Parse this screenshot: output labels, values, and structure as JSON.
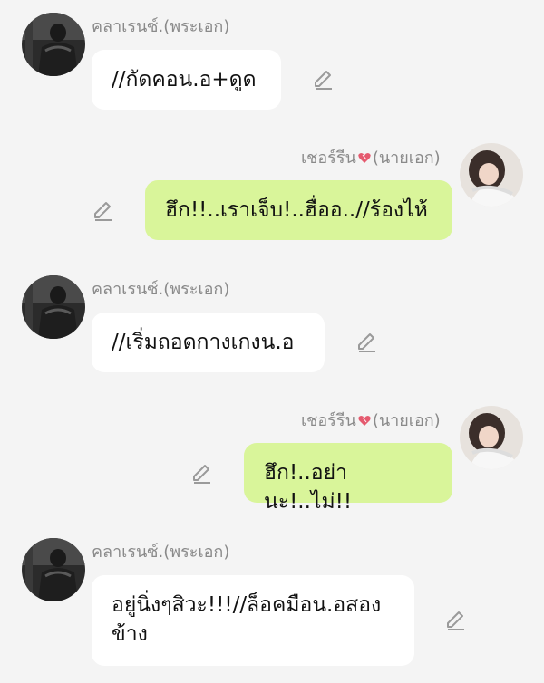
{
  "characters": {
    "left": {
      "name_prefix": "คลาเรนซ์.",
      "name_role": "(พระเอก)",
      "avatar": "avatar-male-dark-photo"
    },
    "right": {
      "name_prefix": "เชอร์รีน",
      "name_role": "(นายเอก)",
      "avatar": "avatar-female-photo",
      "emoji": "heart-emoji"
    }
  },
  "messages": [
    {
      "side": "left",
      "text": "//กัดคอน.อ+ดูด"
    },
    {
      "side": "right",
      "text": "ฮึก!!..เราเจ็บ!..ฮื่ออ..//ร้องไห้"
    },
    {
      "side": "left",
      "text": "//เริ่มถอดกางเกงน.อ"
    },
    {
      "side": "right",
      "text": "ฮึก!..อย่านะ!..ไม่!!"
    },
    {
      "side": "left",
      "text": "อยู่นิ่งๆสิวะ!!!//ล็อคมือน.อสอง ข้าง"
    }
  ],
  "icons": {
    "edit": "pencil-edit-icon"
  },
  "colors": {
    "background": "#f4f4f4",
    "incoming_bubble": "#ffffff",
    "outgoing_bubble": "#d9f59a",
    "name_text": "#8a8a8a",
    "icon": "#9a9a9a"
  }
}
